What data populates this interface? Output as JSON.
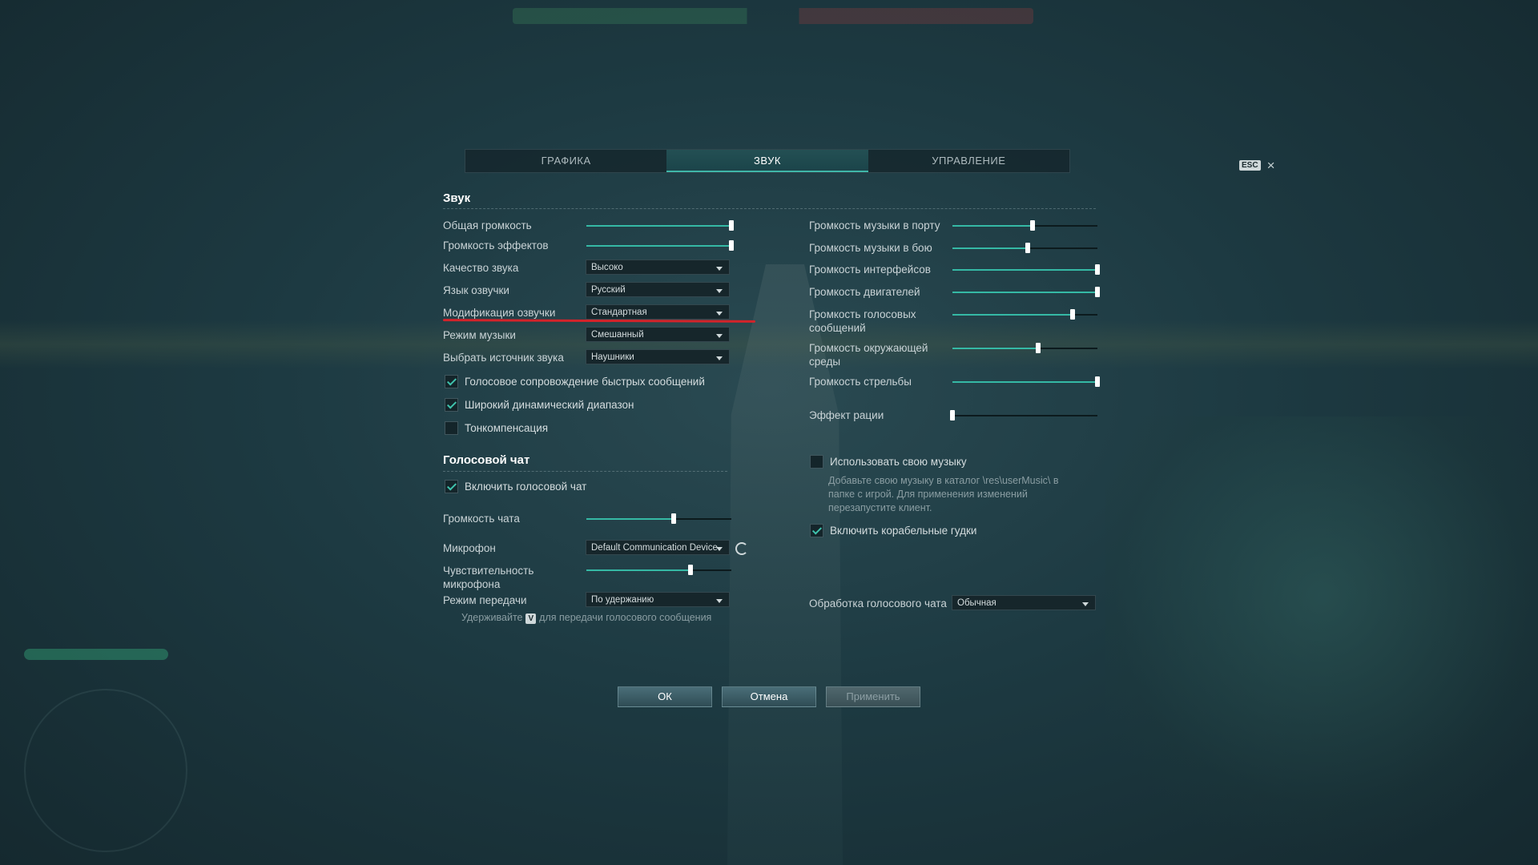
{
  "tabs": {
    "graphics": "ГРАФИКА",
    "sound": "ЗВУК",
    "controls": "УПРАВЛЕНИЕ"
  },
  "esc_label": "ESC",
  "close_glyph": "×",
  "sections": {
    "sound_title": "Звук",
    "voice_chat_title": "Голосовой чат"
  },
  "left": {
    "master_volume": {
      "label": "Общая громкость",
      "value": 100
    },
    "effects_volume": {
      "label": "Громкость эффектов",
      "value": 100
    },
    "sound_quality": {
      "label": "Качество звука",
      "value": "Высоко"
    },
    "voice_language": {
      "label": "Язык озвучки",
      "value": "Русский"
    },
    "voice_mod": {
      "label": "Модификация озвучки",
      "value": "Стандартная"
    },
    "music_mode": {
      "label": "Режим музыки",
      "value": "Смешанный"
    },
    "sound_source": {
      "label": "Выбрать источник звука",
      "value": "Наушники"
    },
    "checks": [
      {
        "label": "Голосовое сопровождение быстрых сообщений",
        "checked": true
      },
      {
        "label": "Широкий динамический диапазон",
        "checked": true
      },
      {
        "label": "Тонкомпенсация",
        "checked": false
      }
    ]
  },
  "voice_chat": {
    "enable": {
      "label": "Включить голосовой чат",
      "checked": true
    },
    "chat_volume": {
      "label": "Громкость чата",
      "value": 60
    },
    "microphone": {
      "label": "Микрофон",
      "value": "Default Communication Device"
    },
    "mic_sensitivity": {
      "label": "Чувствительность микрофона",
      "value": 72
    },
    "transmit_mode": {
      "label": "Режим передачи",
      "value": "По удержанию"
    },
    "hint_before": "Удерживайте",
    "hint_key": "V",
    "hint_after": "для передачи голосового сообщения"
  },
  "right": {
    "sliders": [
      {
        "label": "Громкость музыки в порту",
        "value": 55
      },
      {
        "label": "Громкость музыки в бою",
        "value": 52
      },
      {
        "label": "Громкость интерфейсов",
        "value": 100
      },
      {
        "label": "Громкость двигателей",
        "value": 100
      },
      {
        "label": "Громкость голосовых сообщений",
        "value": 83
      },
      {
        "label": "Громкость окружающей среды",
        "value": 59
      },
      {
        "label": "Громкость стрельбы",
        "value": 100
      },
      {
        "label": "Эффект рации",
        "value": 0
      }
    ],
    "custom_music": {
      "label": "Использовать свою музыку",
      "checked": false,
      "hint": "Добавьте свою музыку в каталог \\res\\userMusic\\ в папке с игрой. Для применения изменений перезапустите клиент."
    },
    "ship_horns": {
      "label": "Включить корабельные гудки",
      "checked": true
    },
    "voice_processing": {
      "label": "Обработка голосового чата",
      "value": "Обычная"
    }
  },
  "buttons": {
    "ok": "ОК",
    "cancel": "Отмена",
    "apply": "Применить"
  },
  "colors": {
    "accent": "#35b9a5",
    "highlight_underline": "#d4232a"
  }
}
